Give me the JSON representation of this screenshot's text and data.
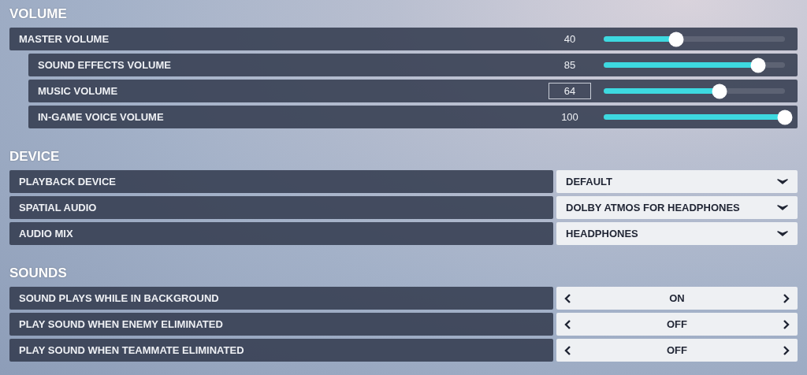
{
  "sections": [
    {
      "title": "VOLUME",
      "items": [
        {
          "kind": "slider",
          "label": "MASTER VOLUME",
          "reading": "40",
          "level": 0.4,
          "focused": false,
          "children": [
            {
              "kind": "slider",
              "label": "SOUND EFFECTS VOLUME",
              "reading": "85",
              "level": 0.85,
              "focused": false
            },
            {
              "kind": "slider",
              "label": "MUSIC VOLUME",
              "reading": "64",
              "level": 0.64,
              "focused": true
            },
            {
              "kind": "slider",
              "label": "IN-GAME VOICE VOLUME",
              "reading": "100",
              "level": 1.0,
              "focused": false
            }
          ]
        }
      ]
    },
    {
      "title": "DEVICE",
      "items": [
        {
          "kind": "dropdown",
          "label": "PLAYBACK DEVICE",
          "value": "DEFAULT"
        },
        {
          "kind": "dropdown",
          "label": "SPATIAL AUDIO",
          "value": "DOLBY ATMOS FOR HEADPHONES"
        },
        {
          "kind": "dropdown",
          "label": "AUDIO MIX",
          "value": "HEADPHONES"
        }
      ]
    },
    {
      "title": "SOUNDS",
      "items": [
        {
          "kind": "toggle",
          "label": "SOUND PLAYS WHILE IN BACKGROUND",
          "value": "ON"
        },
        {
          "kind": "toggle",
          "label": "PLAY SOUND WHEN ENEMY ELIMINATED",
          "value": "OFF"
        },
        {
          "kind": "toggle",
          "label": "PLAY SOUND WHEN TEAMMATE ELIMINATED",
          "value": "OFF"
        }
      ]
    }
  ]
}
